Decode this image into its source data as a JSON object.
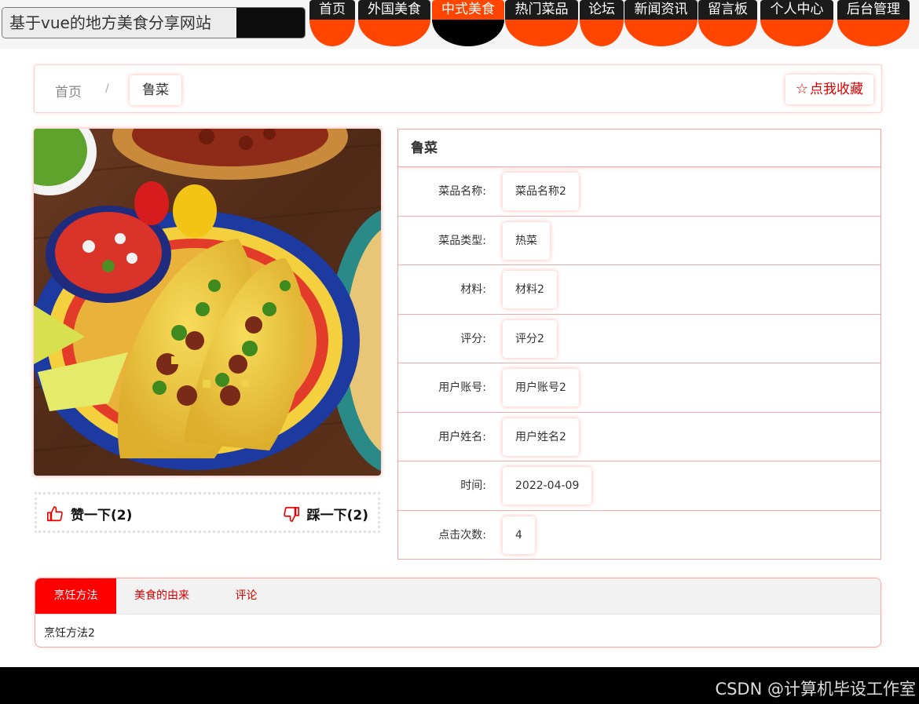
{
  "header": {
    "site_title": "基于vue的地方美食分享网站",
    "nav": [
      {
        "label": "首页",
        "active": false
      },
      {
        "label": "外国美食",
        "active": false
      },
      {
        "label": "中式美食",
        "active": true
      },
      {
        "label": "热门菜品",
        "active": false
      },
      {
        "label": "论坛",
        "active": false
      },
      {
        "label": "新闻资讯",
        "active": false
      },
      {
        "label": "留言板",
        "active": false
      },
      {
        "label": "个人中心",
        "active": false
      },
      {
        "label": "后台管理",
        "active": false
      }
    ]
  },
  "breadcrumb": {
    "home": "首页",
    "separator": "/",
    "current": "鲁菜",
    "favorite_label": "点我收藏"
  },
  "votes": {
    "like_label": "赞一下(2)",
    "dislike_label": "踩一下(2)"
  },
  "detail": {
    "title": "鲁菜",
    "rows": [
      {
        "label": "菜品名称:",
        "value": "菜品名称2"
      },
      {
        "label": "菜品类型:",
        "value": "热菜"
      },
      {
        "label": "材料:",
        "value": "材料2"
      },
      {
        "label": "评分:",
        "value": "评分2"
      },
      {
        "label": "用户账号:",
        "value": "用户账号2"
      },
      {
        "label": "用户姓名:",
        "value": "用户姓名2"
      },
      {
        "label": "时间:",
        "value": "2022-04-09"
      },
      {
        "label": "点击次数:",
        "value": "4"
      }
    ]
  },
  "tabs": {
    "items": [
      {
        "label": "烹饪方法",
        "active": true
      },
      {
        "label": "美食的由来",
        "active": false
      },
      {
        "label": "评论",
        "active": false
      }
    ],
    "content": "烹饪方法2"
  },
  "watermark": "CSDN @计算机毕设工作室",
  "colors": {
    "accent": "#ff4500",
    "tab_active": "#ff0000",
    "nav_dark": "#1b1b1b"
  }
}
